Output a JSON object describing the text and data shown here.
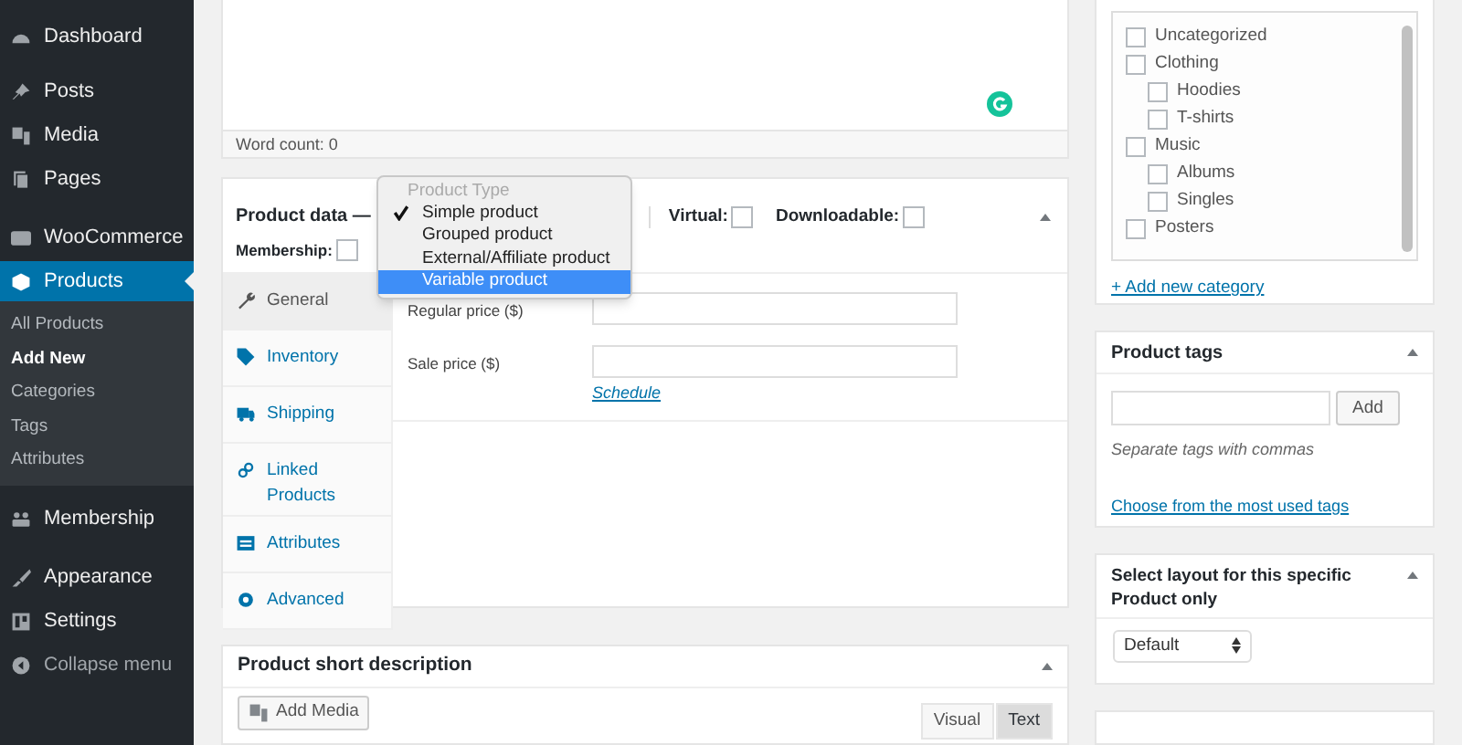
{
  "sidebar": {
    "items": [
      {
        "label": "Dashboard",
        "selected": false
      },
      {
        "label": "Posts",
        "selected": false
      },
      {
        "label": "Media",
        "selected": false
      },
      {
        "label": "Pages",
        "selected": false
      },
      {
        "label": "WooCommerce",
        "selected": false
      },
      {
        "label": "Products",
        "selected": true,
        "children": [
          {
            "label": "All Products",
            "selected": false
          },
          {
            "label": "Add New",
            "selected": true
          },
          {
            "label": "Categories",
            "selected": false
          },
          {
            "label": "Tags",
            "selected": false
          },
          {
            "label": "Attributes",
            "selected": false
          }
        ]
      },
      {
        "label": "Membership",
        "selected": false
      },
      {
        "label": "Appearance",
        "selected": false
      },
      {
        "label": "Settings",
        "selected": false
      }
    ],
    "collapse": "Collapse menu"
  },
  "editor": {
    "word_count": "Word count: 0"
  },
  "product_data": {
    "title": "Product data —",
    "options": [
      {
        "label": "Virtual:",
        "checked": false
      },
      {
        "label": "Downloadable:",
        "checked": false
      },
      {
        "label": "Membership:",
        "checked": false
      }
    ],
    "type_menu": {
      "header": "Product Type",
      "items": [
        {
          "label": "Simple product",
          "selected": true,
          "highlighted": false
        },
        {
          "label": "Grouped product",
          "selected": false,
          "highlighted": false
        },
        {
          "label": "External/Affiliate product",
          "selected": false,
          "highlighted": false
        },
        {
          "label": "Variable product",
          "selected": false,
          "highlighted": true
        }
      ]
    },
    "tabs": [
      {
        "label": "General",
        "selected": true
      },
      {
        "label": "Inventory",
        "selected": false
      },
      {
        "label": "Shipping",
        "selected": false
      },
      {
        "label": "Linked Products",
        "selected": false
      },
      {
        "label": "Attributes",
        "selected": false
      },
      {
        "label": "Advanced",
        "selected": false
      }
    ],
    "fields": [
      {
        "label": "Regular price ($)"
      },
      {
        "label": "Sale price ($)",
        "link": "Schedule"
      }
    ]
  },
  "short_description": {
    "title": "Product short description",
    "add_media": "Add Media",
    "tabs": [
      {
        "label": "Visual",
        "selected": false
      },
      {
        "label": "Text",
        "selected": true
      }
    ]
  },
  "categories": {
    "items": [
      {
        "label": "Uncategorized",
        "checked": false
      },
      {
        "label": "Clothing",
        "checked": false,
        "children": [
          {
            "label": "Hoodies",
            "checked": false
          },
          {
            "label": "T-shirts",
            "checked": false
          }
        ]
      },
      {
        "label": "Music",
        "checked": false,
        "children": [
          {
            "label": "Albums",
            "checked": false
          },
          {
            "label": "Singles",
            "checked": false
          }
        ]
      },
      {
        "label": "Posters",
        "checked": false
      }
    ],
    "add_link": "+ Add new category"
  },
  "tags": {
    "title": "Product tags",
    "button": "Add",
    "hint": "Separate tags with commas",
    "link": "Choose from the most used tags"
  },
  "layout": {
    "title": "Select layout for this specific Product only",
    "value": "Default"
  }
}
